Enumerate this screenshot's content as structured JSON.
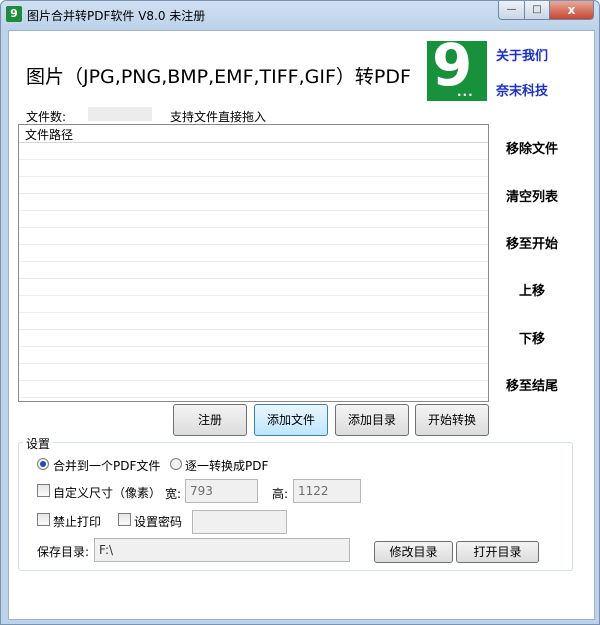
{
  "window": {
    "title": "图片合并转PDF软件 V8.0 未注册",
    "app_icon_glyph": "9",
    "controls": {
      "minimize": "—",
      "maximize": "□",
      "close": "x"
    }
  },
  "header": {
    "main_title": "图片（JPG,PNG,BMP,EMF,TIFF,GIF）转PDF",
    "logo_glyph": "9",
    "logo_dots": "...",
    "links": [
      "关于我们",
      "奈末科技"
    ]
  },
  "file_info": {
    "count_label": "文件数:",
    "count_value": "",
    "drag_hint": "支持文件直接拖入"
  },
  "file_list": {
    "column_header": "文件路径",
    "rows": []
  },
  "side_buttons": [
    "移除文件",
    "清空列表",
    "移至开始",
    "上移",
    "下移",
    "移至结尾"
  ],
  "action_buttons": [
    "注册",
    "添加文件",
    "添加目录",
    "开始转换"
  ],
  "settings": {
    "group_title": "设置",
    "merge_option": "合并到一个PDF文件",
    "separate_option": "逐一转换成PDF",
    "selected_mode": "merge",
    "custom_size_label": "自定义尺寸（像素）",
    "custom_size_checked": false,
    "width_label": "宽:",
    "width_value": "793",
    "height_label": "高:",
    "height_value": "1122",
    "no_print_label": "禁止打印",
    "no_print_checked": false,
    "password_label": "设置密码",
    "password_checked": false,
    "password_value": "",
    "save_dir_label": "保存目录:",
    "save_dir_value": "F:\\",
    "change_dir_button": "修改目录",
    "open_dir_button": "打开目录"
  },
  "colors": {
    "logo_green": "#17913a",
    "link_blue": "#1a2fd0",
    "accent_blue": "#3c7fb1"
  }
}
